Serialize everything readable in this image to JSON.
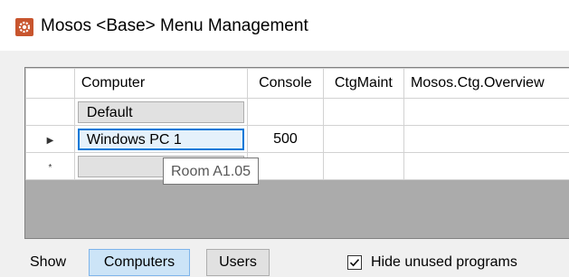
{
  "window": {
    "title": "Mosos <Base> Menu Management",
    "icon": "settings-gear-icon"
  },
  "grid": {
    "columns": [
      "Computer",
      "Console",
      "CtgMaint",
      "Mosos.Ctg.Overview"
    ],
    "rows": [
      {
        "marker": "",
        "computer": "Default",
        "console": "",
        "ctgmaint": "",
        "overview": ""
      },
      {
        "marker": "▶",
        "computer": "Windows PC 1",
        "console": "500",
        "ctgmaint": "",
        "overview": ""
      },
      {
        "marker": "*",
        "computer": "",
        "console": "",
        "ctgmaint": "",
        "overview": ""
      }
    ],
    "tooltip": "Room A1.05"
  },
  "bottom": {
    "show_label": "Show",
    "computers_button": "Computers",
    "users_button": "Users",
    "hide_unused_label": "Hide unused programs",
    "hide_unused_checked": true
  }
}
